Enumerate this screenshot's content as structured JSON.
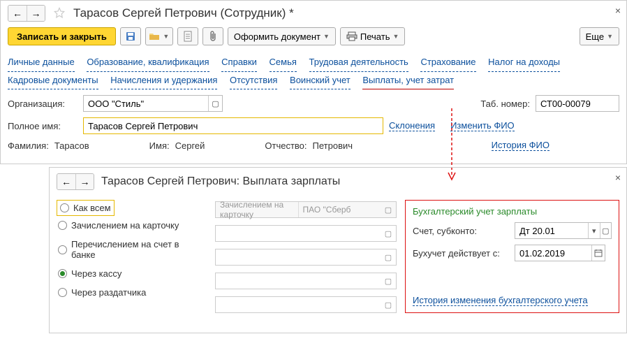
{
  "main": {
    "title": "Тарасов Сергей Петрович (Сотрудник) *",
    "close": "×",
    "toolbar": {
      "save_close": "Записать и закрыть",
      "doc_dropdown": "Оформить документ",
      "print": "Печать",
      "more": "Еще"
    },
    "tabs": [
      "Личные данные",
      "Образование, квалификация",
      "Справки",
      "Семья",
      "Трудовая деятельность",
      "Страхование",
      "Налог на доходы",
      "Кадровые документы",
      "Начисления и удержания",
      "Отсутствия",
      "Воинский учет",
      "Выплаты, учет затрат"
    ],
    "org_label": "Организация:",
    "org_value": "ООО \"Стиль\"",
    "tabno_label": "Таб. номер:",
    "tabno_value": "СТ00-00079",
    "fullname_label": "Полное имя:",
    "fullname_value": "Тарасов Сергей Петрович",
    "sklon": "Склонения",
    "change_fio": "Изменить ФИО",
    "surname_label": "Фамилия:",
    "surname_value": "Тарасов",
    "name_label": "Имя:",
    "name_value": "Сергей",
    "patr_label": "Отчество:",
    "patr_value": "Петрович",
    "history_fio": "История ФИО"
  },
  "sub": {
    "title": "Тарасов Сергей Петрович: Выплата зарплаты",
    "close": "×",
    "radios": [
      "Как всем",
      "Зачислением на карточку",
      "Перечислением на счет в банке",
      "Через кассу",
      "Через раздатчика"
    ],
    "selected_radio": 3,
    "disabled1": "Зачислением на карточку",
    "disabled2": "ПАО \"Сберб",
    "right": {
      "title": "Бухгалтерский учет зарплаты",
      "acct_label": "Счет, субконто:",
      "acct_value": "Дт 20.01",
      "date_label": "Бухучет действует с:",
      "date_value": "01.02.2019",
      "history": "История изменения бухгалтерского учета"
    }
  }
}
